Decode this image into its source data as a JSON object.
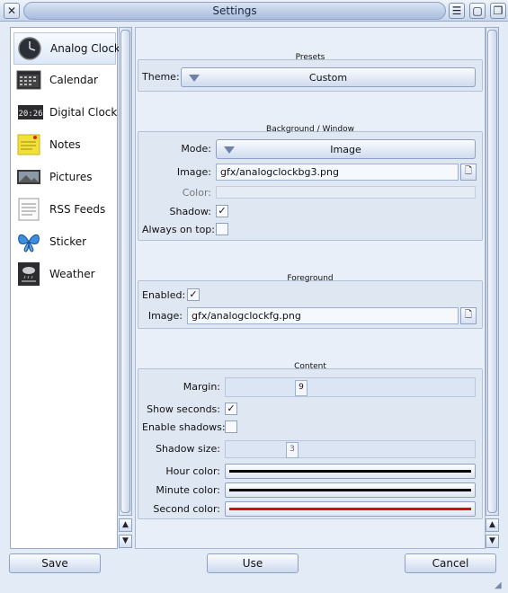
{
  "window": {
    "title": "Settings"
  },
  "sidebar": {
    "items": [
      {
        "label": "Analog Clock",
        "icon": "analog-clock-icon",
        "selected": true
      },
      {
        "label": "Calendar",
        "icon": "calendar-icon"
      },
      {
        "label": "Digital Clock",
        "icon": "digital-clock-icon",
        "clock_text": "20:26"
      },
      {
        "label": "Notes",
        "icon": "notes-icon"
      },
      {
        "label": "Pictures",
        "icon": "pictures-icon"
      },
      {
        "label": "RSS Feeds",
        "icon": "rss-feeds-icon"
      },
      {
        "label": "Sticker",
        "icon": "sticker-icon"
      },
      {
        "label": "Weather",
        "icon": "weather-icon"
      }
    ]
  },
  "presets": {
    "title": "Presets",
    "theme_label": "Theme:",
    "theme_value": "Custom"
  },
  "background": {
    "title": "Background / Window",
    "mode_label": "Mode:",
    "mode_value": "Image",
    "image_label": "Image:",
    "image_value": "gfx/analogclockbg3.png",
    "color_label": "Color:",
    "shadow_label": "Shadow:",
    "shadow_checked": true,
    "ontop_label": "Always on top:",
    "ontop_checked": false
  },
  "foreground": {
    "title": "Foreground",
    "enabled_label": "Enabled:",
    "enabled_checked": true,
    "image_label": "Image:",
    "image_value": "gfx/analogclockfg.png"
  },
  "content": {
    "title": "Content",
    "margin_label": "Margin:",
    "margin_value": "9",
    "seconds_label": "Show seconds:",
    "seconds_checked": true,
    "shadows_label": "Enable shadows:",
    "shadows_checked": false,
    "shadow_size_label": "Shadow size:",
    "shadow_size_value": "3",
    "hour_label": "Hour color:",
    "hour_color": "#000000",
    "minute_label": "Minute color:",
    "minute_color": "#000000",
    "second_label": "Second color:",
    "second_color": "#cc1111"
  },
  "buttons": {
    "save": "Save",
    "use": "Use",
    "cancel": "Cancel"
  },
  "glyphs": {
    "check": "✓",
    "up": "▲",
    "down": "▼",
    "file": "🗋",
    "close": "✕"
  }
}
